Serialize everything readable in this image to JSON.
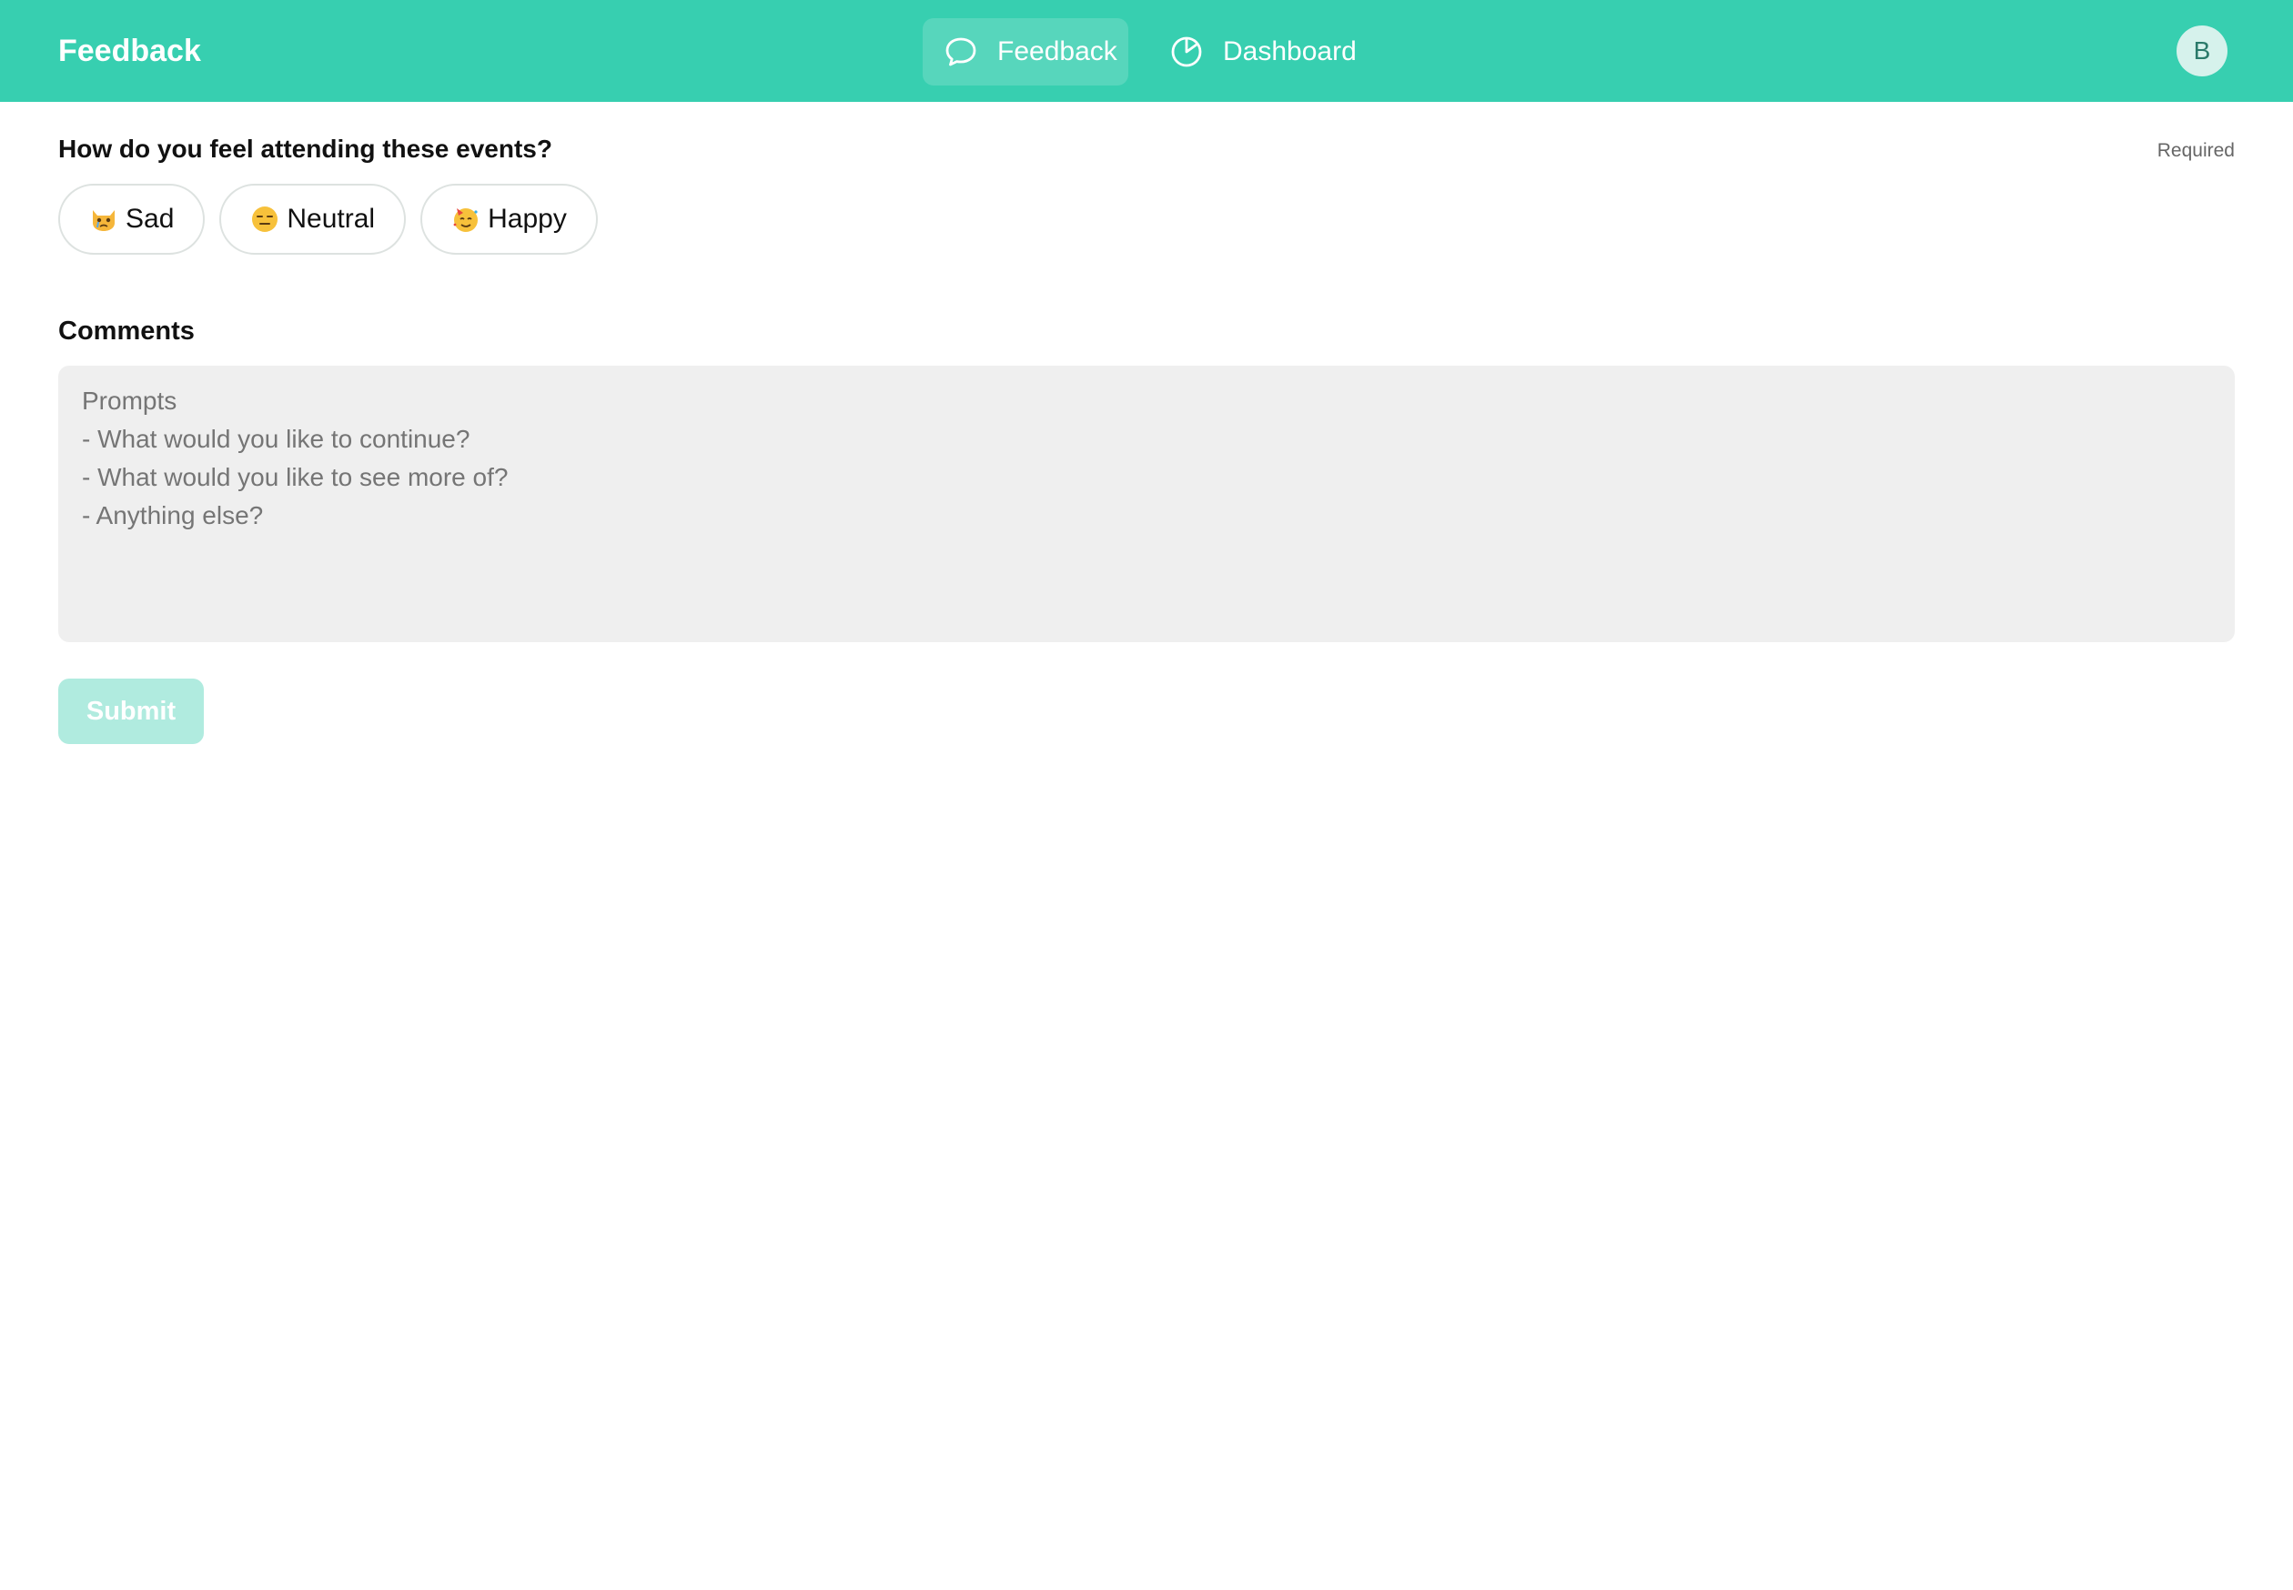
{
  "header": {
    "brand": "Feedback",
    "nav": [
      {
        "label": "Feedback",
        "icon": "chat-bubble-icon",
        "active": true
      },
      {
        "label": "Dashboard",
        "icon": "pie-chart-icon",
        "active": false
      }
    ],
    "avatar_initial": "B"
  },
  "form": {
    "question": "How do you feel attending these events?",
    "required_label": "Required",
    "choices": [
      {
        "label": "Sad",
        "icon": "crying-cat-emoji-icon"
      },
      {
        "label": "Neutral",
        "icon": "expressionless-face-emoji-icon"
      },
      {
        "label": "Happy",
        "icon": "party-face-emoji-icon"
      }
    ],
    "comments_label": "Comments",
    "comments_placeholder": "Prompts\n- What would you like to continue?\n- What would you like to see more of?\n- Anything else?",
    "submit_label": "Submit"
  },
  "colors": {
    "accent": "#37cfb0",
    "submit_disabled": "#b0ebdf",
    "textarea_bg": "#efefef"
  }
}
